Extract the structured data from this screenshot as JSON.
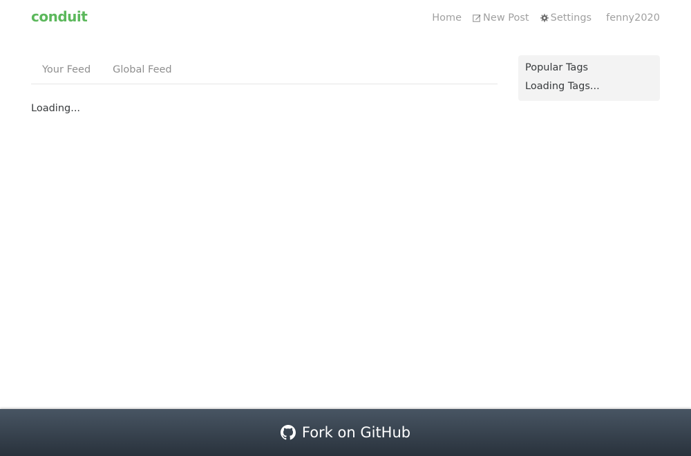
{
  "brand": {
    "name": "conduit",
    "color": "#5cb85c"
  },
  "nav": {
    "home": "Home",
    "new_post": "New Post",
    "settings": "Settings",
    "username": "fenny2020",
    "icons": {
      "new_post": "edit-icon",
      "settings": "gear-icon"
    }
  },
  "feed": {
    "tabs": [
      "Your Feed",
      "Global Feed"
    ],
    "loading_text": "Loading..."
  },
  "sidebar": {
    "title": "Popular Tags",
    "loading_text": "Loading Tags..."
  },
  "footer": {
    "label": "Fork on GitHub",
    "icon": "github-icon",
    "gradient": [
      "#485563",
      "#29323c"
    ]
  }
}
